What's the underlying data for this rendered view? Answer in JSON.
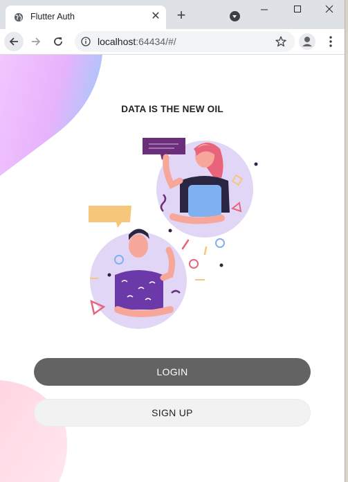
{
  "browser": {
    "tab_title": "Flutter Auth",
    "url_host": "localhost",
    "url_rest": ":64434/#/"
  },
  "page": {
    "headline": "DATA IS THE NEW OIL",
    "login_label": "LOGIN",
    "signup_label": "SIGN UP"
  },
  "colors": {
    "tabbar_bg": "#dee1e6",
    "login_bg": "#636363",
    "signup_bg": "#f2f2f2",
    "blob_purple": "#e8b4f8",
    "blob_pink": "#ffd3e0"
  },
  "icons": [
    "globe-icon",
    "close-icon",
    "plus-icon",
    "tab-search-icon",
    "minimize-icon",
    "maximize-icon",
    "window-close-icon",
    "back-icon",
    "forward-icon",
    "reload-icon",
    "info-icon",
    "star-icon",
    "profile-icon",
    "menu-icon"
  ]
}
